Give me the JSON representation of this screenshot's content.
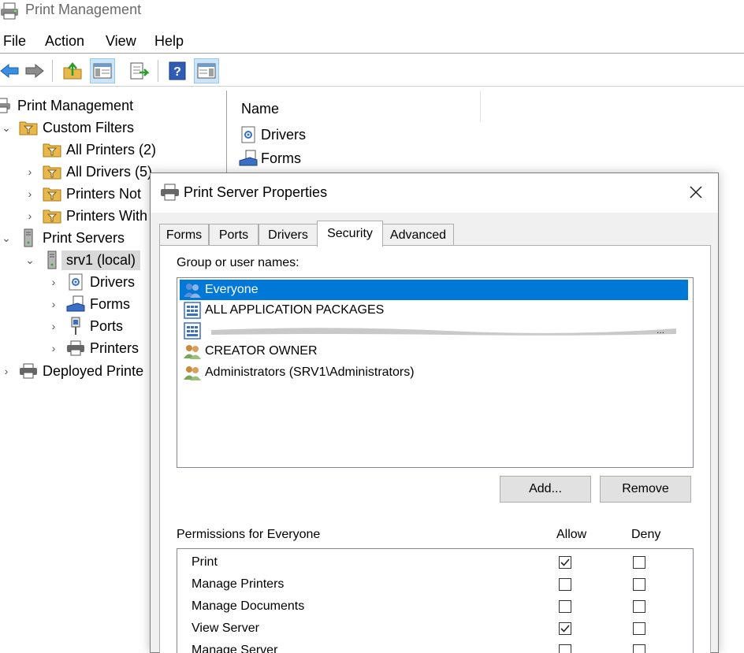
{
  "window": {
    "title": "Print Management"
  },
  "menu": [
    "File",
    "Action",
    "View",
    "Help"
  ],
  "toolbar": {
    "buttons": [
      "back-icon",
      "forward-icon",
      "up-folder-icon",
      "show-hide-tree-icon",
      "export-list-icon",
      "help-icon",
      "show-hide-action-pane-icon"
    ]
  },
  "tree": {
    "items": [
      {
        "label": "Print Management"
      },
      {
        "label": "Custom Filters"
      },
      {
        "label": "All Printers (2)"
      },
      {
        "label": "All Drivers (5)"
      },
      {
        "label": "Printers Not"
      },
      {
        "label": "Printers With"
      },
      {
        "label": "Print Servers"
      },
      {
        "label": "srv1 (local)"
      },
      {
        "label": "Drivers"
      },
      {
        "label": "Forms"
      },
      {
        "label": "Ports"
      },
      {
        "label": "Printers"
      },
      {
        "label": "Deployed Printe"
      }
    ]
  },
  "list": {
    "column": "Name",
    "items": [
      "Drivers",
      "Forms"
    ]
  },
  "dialog": {
    "title": "Print Server Properties",
    "tabs": [
      "Forms",
      "Ports",
      "Drivers",
      "Security",
      "Advanced"
    ],
    "active_tab": "Security",
    "group_label": "Group or user names:",
    "users": [
      "Everyone",
      "ALL APPLICATION PACKAGES",
      "",
      "CREATOR OWNER",
      "Administrators (SRV1\\Administrators)"
    ],
    "add_button": "Add...",
    "remove_button": "Remove",
    "permissions_label": "Permissions for Everyone",
    "allow_label": "Allow",
    "deny_label": "Deny",
    "permissions": [
      {
        "name": "Print",
        "allow": true,
        "deny": false
      },
      {
        "name": "Manage Printers",
        "allow": false,
        "deny": false
      },
      {
        "name": "Manage Documents",
        "allow": false,
        "deny": false
      },
      {
        "name": "View Server",
        "allow": true,
        "deny": false
      },
      {
        "name": "Manage Server",
        "allow": false,
        "deny": false
      }
    ]
  },
  "colors": {
    "selection": "#0078d7",
    "dialog_bg": "#f0f0f0",
    "toolbar_active": "#cce4f7"
  }
}
